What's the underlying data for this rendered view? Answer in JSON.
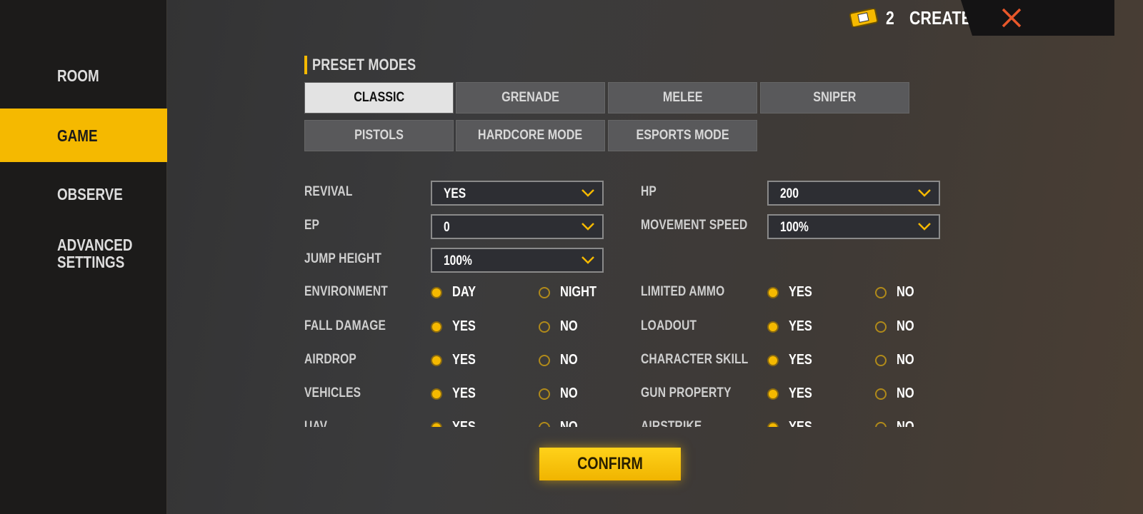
{
  "sidebar": {
    "items": [
      {
        "label": "ROOM",
        "active": false
      },
      {
        "label": "GAME",
        "active": true
      },
      {
        "label": "OBSERVE",
        "active": false
      },
      {
        "label": "ADVANCED\nSETTINGS",
        "active": false
      }
    ]
  },
  "header": {
    "ticket_icon": "room-card-icon",
    "ticket_count": "2",
    "create_label": "CREATE",
    "close_icon": "close-icon"
  },
  "preset": {
    "title": "PRESET MODES",
    "selected": "CLASSIC",
    "modes": [
      "CLASSIC",
      "GRENADE",
      "MELEE",
      "SNIPER",
      "PISTOLS",
      "HARDCORE MODE",
      "ESPORTS MODE"
    ]
  },
  "dropdowns": [
    {
      "label": "REVIVAL",
      "value": "YES"
    },
    {
      "label": "HP",
      "value": "200"
    },
    {
      "label": "EP",
      "value": "0"
    },
    {
      "label": "MOVEMENT SPEED",
      "value": "100%"
    },
    {
      "label": "JUMP HEIGHT",
      "value": "100%"
    }
  ],
  "toggles": [
    {
      "label": "ENVIRONMENT",
      "options": [
        "DAY",
        "NIGHT"
      ],
      "selected": 0
    },
    {
      "label": "LIMITED AMMO",
      "options": [
        "YES",
        "NO"
      ],
      "selected": 0
    },
    {
      "label": "FALL DAMAGE",
      "options": [
        "YES",
        "NO"
      ],
      "selected": 0
    },
    {
      "label": "LOADOUT",
      "options": [
        "YES",
        "NO"
      ],
      "selected": 0
    },
    {
      "label": "AIRDROP",
      "options": [
        "YES",
        "NO"
      ],
      "selected": 0
    },
    {
      "label": "CHARACTER SKILL",
      "options": [
        "YES",
        "NO"
      ],
      "selected": 0
    },
    {
      "label": "VEHICLES",
      "options": [
        "YES",
        "NO"
      ],
      "selected": 0
    },
    {
      "label": "GUN PROPERTY",
      "options": [
        "YES",
        "NO"
      ],
      "selected": 0
    },
    {
      "label": "UAV",
      "options": [
        "YES",
        "NO"
      ],
      "selected": 0
    },
    {
      "label": "AIRSTRIKE",
      "options": [
        "YES",
        "NO"
      ],
      "selected": 0
    }
  ],
  "confirm_label": "CONFIRM",
  "colors": {
    "accent": "#f5b900",
    "close": "#e8572a"
  }
}
